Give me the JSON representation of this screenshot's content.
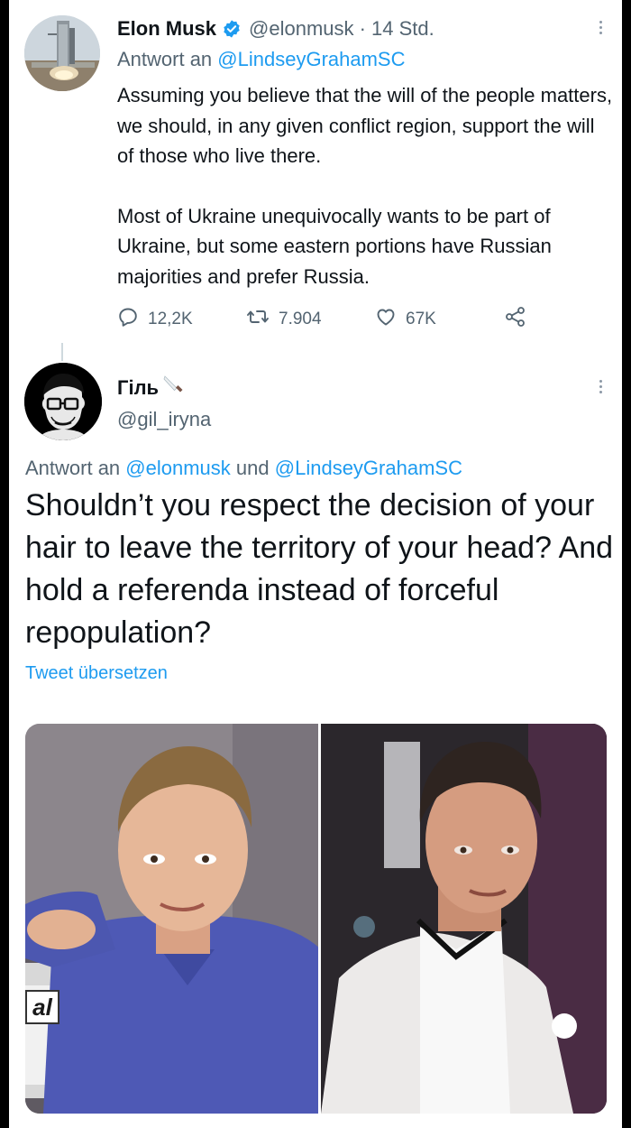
{
  "tweet1": {
    "name": "Elon Musk",
    "handle_time": "@elonmusk · 14 Std.",
    "reply_prefix": "Antwort an",
    "reply_mention": "@LindseyGrahamSC",
    "paragraph1": "Assuming you believe that the will of the people matters, we should, in any given conflict region, support the will of those who live there.",
    "paragraph2": "Most of Ukraine unequivocally wants to be part of Ukraine, but some eastern portions have Russian majorities and prefer Russia.",
    "replies": "12,2K",
    "retweets": "7.904",
    "likes": "67K"
  },
  "tweet2": {
    "name": "Гіль",
    "handle": "@gil_iryna",
    "reply_prefix": "Antwort an",
    "reply_mention1": "@elonmusk",
    "reply_and": "und",
    "reply_mention2": "@LindseyGrahamSC",
    "body": "Shouldn’t you respect the decision of your hair to leave the territory of your head? And hold a referenda instead of forceful repopulation?",
    "translate_label": "Tweet übersetzen"
  },
  "media": {
    "monitor_text": "al"
  },
  "colors": {
    "accent": "#1d9bf0",
    "secondary_text": "#536471",
    "primary_text": "#0f1419"
  },
  "icons": [
    "verified-badge-icon",
    "more-icon",
    "reply-icon",
    "retweet-icon",
    "like-icon",
    "share-icon",
    "knife-emoji-icon"
  ]
}
